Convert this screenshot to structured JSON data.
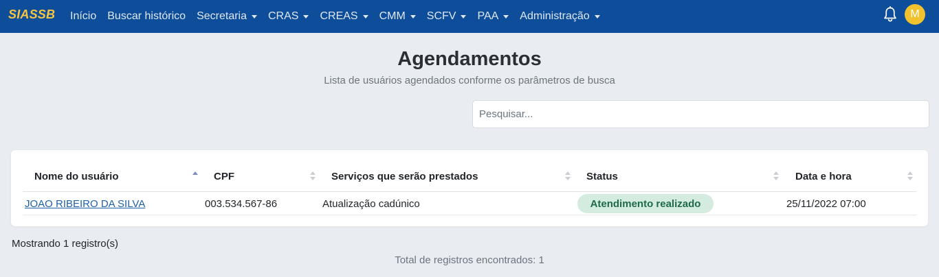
{
  "app": {
    "brand": "SIASSB",
    "avatar_initial": "M"
  },
  "nav": {
    "items": [
      {
        "label": "Início",
        "dropdown": false
      },
      {
        "label": "Buscar histórico",
        "dropdown": false
      },
      {
        "label": "Secretaria",
        "dropdown": true
      },
      {
        "label": "CRAS",
        "dropdown": true
      },
      {
        "label": "CREAS",
        "dropdown": true
      },
      {
        "label": "CMM",
        "dropdown": true
      },
      {
        "label": "SCFV",
        "dropdown": true
      },
      {
        "label": "PAA",
        "dropdown": true
      },
      {
        "label": "Administração",
        "dropdown": true
      }
    ]
  },
  "page": {
    "title": "Agendamentos",
    "subtitle": "Lista de usuários agendados conforme os parâmetros de busca"
  },
  "search": {
    "placeholder": "Pesquisar...",
    "value": ""
  },
  "table": {
    "columns": [
      {
        "label": "Nome do usuário",
        "sort": "asc"
      },
      {
        "label": "CPF",
        "sort": "none"
      },
      {
        "label": "Serviços que serão prestados",
        "sort": "none"
      },
      {
        "label": "Status",
        "sort": "none"
      },
      {
        "label": "Data e hora",
        "sort": "none"
      }
    ],
    "rows": [
      {
        "name": "JOAO RIBEIRO DA SILVA",
        "cpf": "003.534.567-86",
        "services": "Atualização cadúnico",
        "status": "Atendimento realizado",
        "datetime": "25/11/2022 07:00"
      }
    ]
  },
  "footer": {
    "showing": "Mostrando 1 registro(s)",
    "total": "Total de registros encontrados: 1"
  },
  "colors": {
    "navbar": "#0d4d9a",
    "brand": "#f5c542",
    "avatar": "#f2c12e",
    "status_bg": "#d4ebe0",
    "status_text": "#1f6b47",
    "link": "#1f5fa8"
  }
}
